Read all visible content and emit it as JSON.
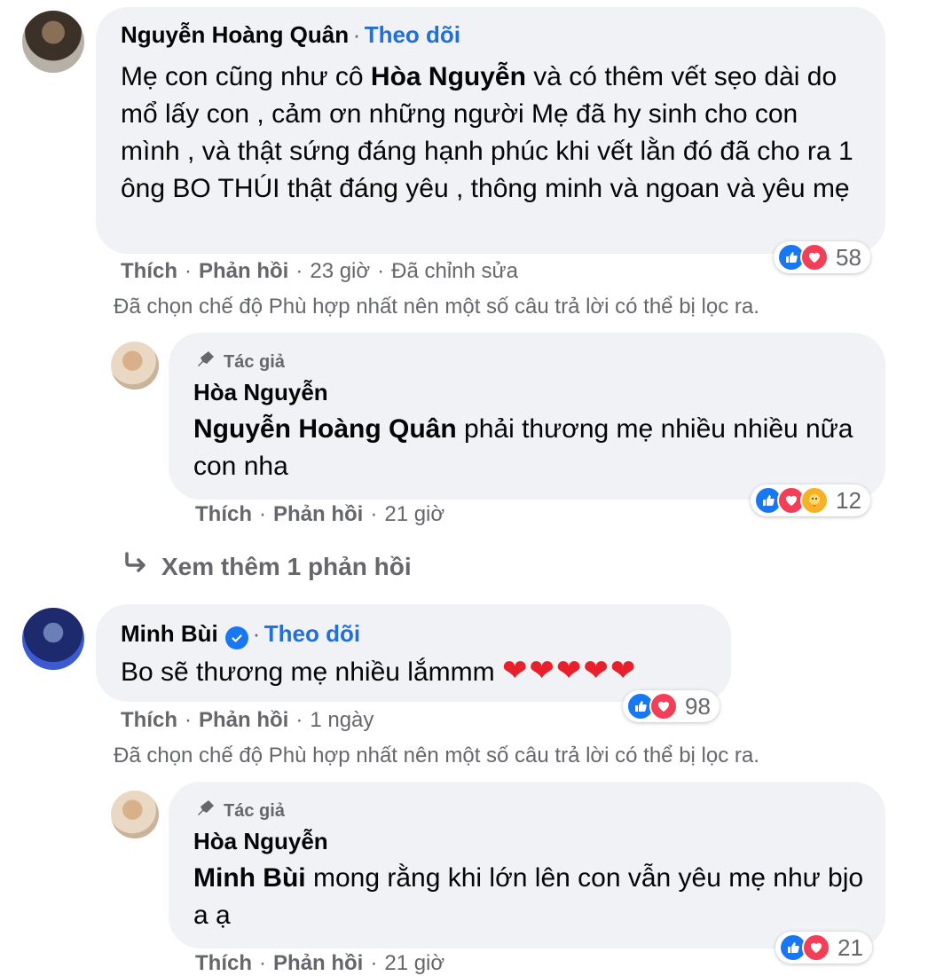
{
  "comment1": {
    "name": "Nguyễn Hoàng Quân",
    "sep": "·",
    "follow": "Theo dõi",
    "text_pre": "Mẹ con cũng như cô ",
    "mention": "Hòa Nguyễn",
    "text_post": " và có thêm vết sẹo dài do mổ lấy con , cảm ơn những người Mẹ đã hy sinh cho con mình , và thật sứng đáng hạnh phúc khi vết lằn đó đã cho ra 1 ông BO THÚI thật đáng yêu , thông minh và ngoan và yêu mẹ",
    "like": "Thích",
    "reply": "Phản hồi",
    "time": "23 giờ",
    "edited": "Đã chỉnh sửa",
    "reactions": "58",
    "notice": "Đã chọn chế độ Phù hợp nhất nên một số câu trả lời có thể bị lọc ra."
  },
  "reply1": {
    "tag": "Tác giả",
    "name": "Hòa Nguyễn",
    "mention": "Nguyễn Hoàng Quân",
    "text": " phải thương mẹ nhiều nhiều nữa con nha",
    "like": "Thích",
    "reply": "Phản hồi",
    "time": "21 giờ",
    "reactions": "12"
  },
  "see_more": "Xem thêm 1 phản hồi",
  "comment2": {
    "name": "Minh Bùi",
    "follow": "Theo dõi",
    "text": "Bo sẽ thương mẹ nhiều lắmmm ",
    "hearts": "❤❤❤❤❤",
    "like": "Thích",
    "reply": "Phản hồi",
    "time": "1 ngày",
    "reactions": "98",
    "notice": "Đã chọn chế độ Phù hợp nhất nên một số câu trả lời có thể bị lọc ra."
  },
  "reply2": {
    "tag": "Tác giả",
    "name": "Hòa Nguyễn",
    "mention": "Minh Bùi",
    "text": " mong rằng khi lớn lên con vẫn yêu mẹ như bjo a ạ",
    "like": "Thích",
    "reply": "Phản hồi",
    "time": "21 giờ",
    "reactions": "21"
  },
  "colors": {
    "bubble": "#f0f2f5",
    "link": "#216fdb",
    "muted": "#65676b",
    "like": "#1877f2",
    "love": "#f33e58"
  }
}
